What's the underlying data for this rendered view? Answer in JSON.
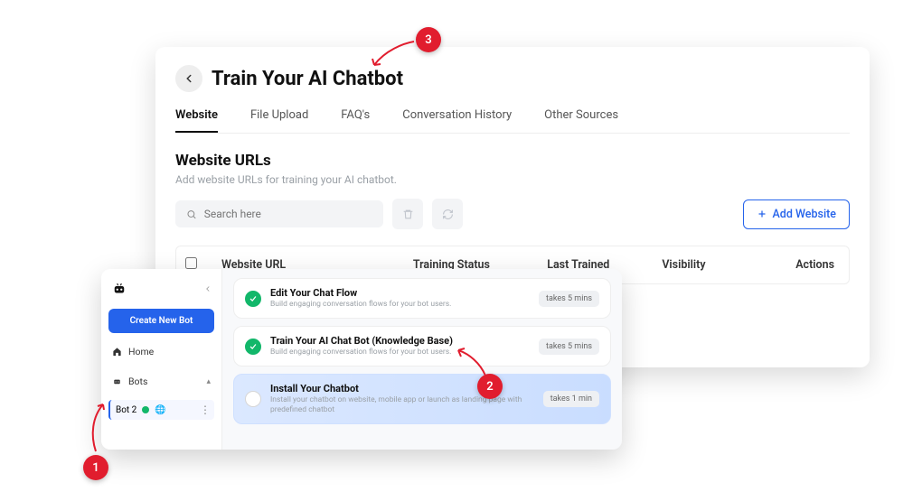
{
  "header": {
    "title": "Train Your AI Chatbot"
  },
  "tabs": [
    "Website",
    "File Upload",
    "FAQ's",
    "Conversation History",
    "Other Sources"
  ],
  "section": {
    "heading": "Website URLs",
    "subtext": "Add website URLs for training your AI chatbot."
  },
  "search": {
    "placeholder": "Search here"
  },
  "add_btn": "Add Website",
  "table": {
    "cols": [
      "Website URL",
      "Training Status",
      "Last Trained",
      "Visibility",
      "Actions"
    ]
  },
  "sidebar": {
    "create": "Create New Bot",
    "home": "Home",
    "bots": "Bots",
    "bot_item": "Bot 2"
  },
  "steps": [
    {
      "title": "Edit Your Chat Flow",
      "desc": "Build engaging conversation flows for your bot users.",
      "badge": "takes 5 mins",
      "done": true
    },
    {
      "title": "Train Your AI Chat Bot (Knowledge Base)",
      "desc": "Build engaging conversation flows for your bot users.",
      "badge": "takes 5 mins",
      "done": true
    },
    {
      "title": "Install Your Chatbot",
      "desc": "Install your chatbot on website, mobile app or launch as landing page with predefined chatbot",
      "badge": "takes 1 min",
      "done": false,
      "active": true
    }
  ],
  "callouts": {
    "1": "1",
    "2": "2",
    "3": "3"
  }
}
